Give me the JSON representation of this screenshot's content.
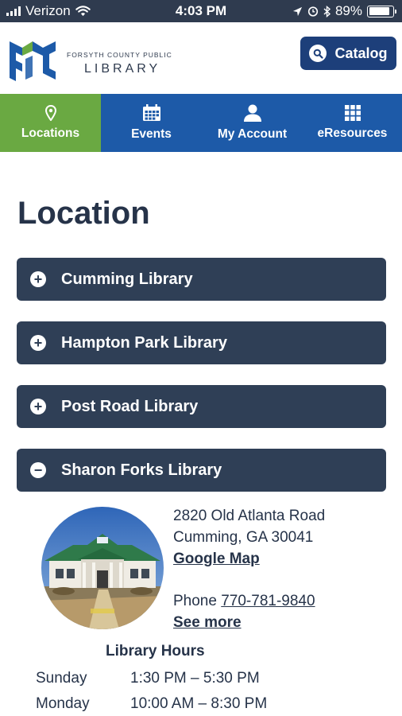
{
  "status_bar": {
    "carrier": "Verizon",
    "time": "4:03 PM",
    "battery_percent": "89%",
    "battery_level": 0.89
  },
  "header": {
    "org_name": "FORSYTH COUNTY PUBLIC",
    "library_word": "LIBRARY",
    "catalog_label": "Catalog",
    "colors": {
      "logo_blue": "#1d5aa8",
      "logo_green": "#6aa942",
      "button": "#1d3f7a"
    }
  },
  "nav": {
    "items": [
      {
        "label": "Locations",
        "icon": "map-pin-icon",
        "active": true
      },
      {
        "label": "Events",
        "icon": "calendar-icon",
        "active": false
      },
      {
        "label": "My Account",
        "icon": "user-icon",
        "active": false
      },
      {
        "label": "eResources",
        "icon": "grid-icon",
        "active": false
      }
    ],
    "colors": {
      "active": "#6aa942",
      "default": "#1d5aa8"
    }
  },
  "page": {
    "title": "Location",
    "accordion": [
      {
        "label": "Cumming Library",
        "sign": "+",
        "expanded": false
      },
      {
        "label": "Hampton Park Library",
        "sign": "+",
        "expanded": false
      },
      {
        "label": "Post Road Library",
        "sign": "+",
        "expanded": false
      },
      {
        "label": "Sharon Forks Library",
        "sign": "−",
        "expanded": true
      }
    ],
    "branch_detail": {
      "address_line1": "2820 Old Atlanta Road",
      "address_line2": "Cumming, GA 30041",
      "map_link": "Google Map",
      "phone_label": "Phone",
      "phone_number": "770-781-9840",
      "see_more": "See more",
      "hours_title": "Library Hours",
      "hours": [
        {
          "day": "Sunday",
          "time": "1:30 PM – 5:30 PM"
        },
        {
          "day": "Monday",
          "time": "10:00 AM – 8:30 PM"
        }
      ]
    }
  }
}
